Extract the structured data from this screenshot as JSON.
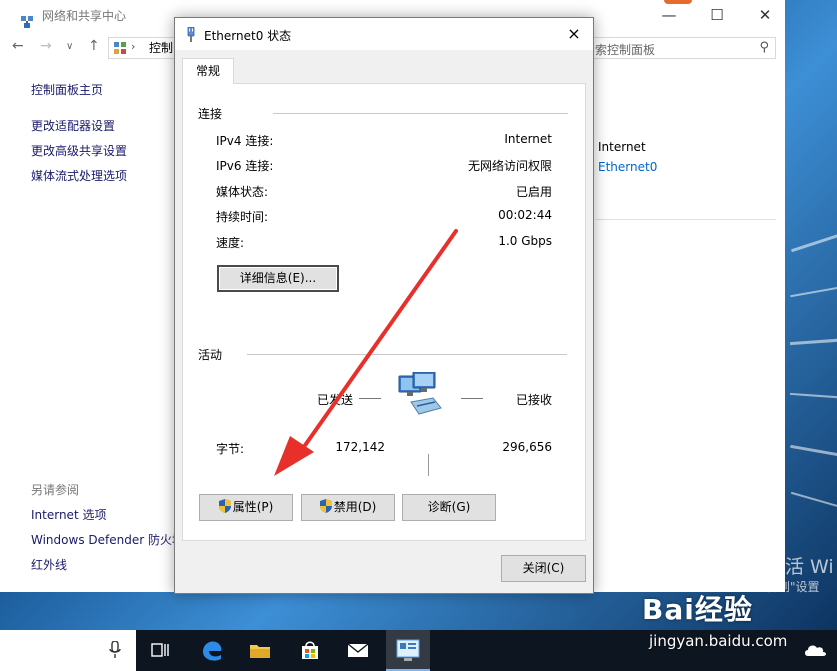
{
  "background_window": {
    "title": "网络和共享中心",
    "address_prefix": "控制",
    "search_placeholder": "索控制面板",
    "sidebar": [
      "控制面板主页",
      "更改适配器设置",
      "更改高级共享设置",
      "媒体流式处理选项"
    ],
    "see_also_title": "另请参阅",
    "see_also": [
      "Internet 选项",
      "Windows Defender 防火墙",
      "红外线"
    ],
    "network_access_value": "Internet",
    "network_connection_value": "Ethernet0"
  },
  "dialog": {
    "title": "Ethernet0 状态",
    "close_glyph": "×",
    "tab_general": "常规",
    "connection_group": "连接",
    "rows": [
      {
        "label": "IPv4 连接:",
        "value": "Internet"
      },
      {
        "label": "IPv6 连接:",
        "value": "无网络访问权限"
      },
      {
        "label": "媒体状态:",
        "value": "已启用"
      },
      {
        "label": "持续时间:",
        "value": "00:02:44"
      },
      {
        "label": "速度:",
        "value": "1.0 Gbps"
      }
    ],
    "details_button": "详细信息(E)...",
    "activity_group": "活动",
    "sent_label": "已发送",
    "received_label": "已接收",
    "bytes_label": "字节:",
    "bytes_sent": "172,142",
    "bytes_received": "296,656",
    "properties_button": "属性(P)",
    "disable_button": "禁用(D)",
    "diagnose_button": "诊断(G)",
    "close_button": "关闭(C)"
  },
  "desktop": {
    "watermark_line1": "激活 Wi",
    "watermark_line2": "转到\"设置"
  },
  "overlay": {
    "brand": "Bai经验",
    "brand_url": "jingyan.baidu.com"
  },
  "colors": {
    "link": "#1a1a6a",
    "arrow": "#e8302b",
    "taskbar": "#0d1520",
    "dialog_bg": "#f0f0f0"
  }
}
